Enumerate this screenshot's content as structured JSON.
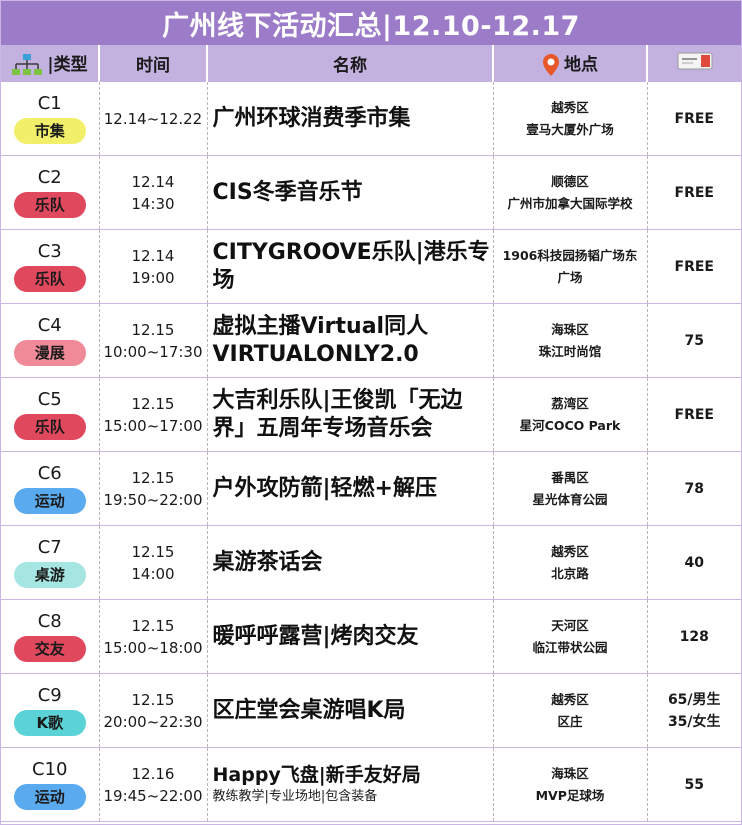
{
  "title": "广州线下活动汇总|12.10-12.17",
  "headers": {
    "type": "|类型",
    "time": "时间",
    "name": "名称",
    "location": "地点"
  },
  "icons": {
    "type": "hierarchy-icon",
    "location": "location-pin-icon",
    "ticket": "ticket-icon"
  },
  "colors": {
    "title_bg": "#9c7cc8",
    "header_bg": "#c3b1e0",
    "market": "#f2f06a",
    "band": "#e0485e",
    "comic": "#f08a98",
    "sport": "#5aaaf0",
    "boardgame": "#a6e6e2",
    "social": "#e0485e",
    "karaoke": "#5ad2d6"
  },
  "rows": [
    {
      "code": "C1",
      "tag": "市集",
      "tag_color": "#f2f06a",
      "time1": "12.14~12.22",
      "time2": "",
      "name": "广州环球消费季市集",
      "sub": "",
      "district": "越秀区",
      "place": "壹马大厦外广场",
      "price1": "FREE",
      "price2": ""
    },
    {
      "code": "C2",
      "tag": "乐队",
      "tag_color": "#e0485e",
      "time1": "12.14",
      "time2": "14:30",
      "name": "CIS冬季音乐节",
      "sub": "",
      "district": "顺德区",
      "place": "广州市加拿大国际学校",
      "price1": "FREE",
      "price2": ""
    },
    {
      "code": "C3",
      "tag": "乐队",
      "tag_color": "#e0485e",
      "time1": "12.14",
      "time2": "19:00",
      "name": "CITYGROOVE乐队|港乐专场",
      "sub": "",
      "district": "1906科技园扬韬广场东",
      "place": "广场",
      "price1": "FREE",
      "price2": ""
    },
    {
      "code": "C4",
      "tag": "漫展",
      "tag_color": "#f08a98",
      "time1": "12.15",
      "time2": "10:00~17:30",
      "name": "虚拟主播Virtual同人VIRTUALONLY2.0",
      "sub": "",
      "district": "海珠区",
      "place": "珠江时尚馆",
      "price1": "75",
      "price2": ""
    },
    {
      "code": "C5",
      "tag": "乐队",
      "tag_color": "#e0485e",
      "time1": "12.15",
      "time2": "15:00~17:00",
      "name": "大吉利乐队|王俊凯「无边界」五周年专场音乐会",
      "sub": "",
      "district": "荔湾区",
      "place": "星河COCO Park",
      "price1": "FREE",
      "price2": ""
    },
    {
      "code": "C6",
      "tag": "运动",
      "tag_color": "#5aaaf0",
      "time1": "12.15",
      "time2": "19:50~22:00",
      "name": "户外攻防箭|轻燃+解压",
      "sub": "",
      "district": "番禺区",
      "place": "星光体育公园",
      "price1": "78",
      "price2": ""
    },
    {
      "code": "C7",
      "tag": "桌游",
      "tag_color": "#a6e6e2",
      "time1": "12.15",
      "time2": "14:00",
      "name": "桌游茶话会",
      "sub": "",
      "district": "越秀区",
      "place": "北京路",
      "price1": "40",
      "price2": ""
    },
    {
      "code": "C8",
      "tag": "交友",
      "tag_color": "#e0485e",
      "time1": "12.15",
      "time2": "15:00~18:00",
      "name": "暖呼呼露营|烤肉交友",
      "sub": "",
      "district": "天河区",
      "place": "临江带状公园",
      "price1": "128",
      "price2": ""
    },
    {
      "code": "C9",
      "tag": "K歌",
      "tag_color": "#5ad2d6",
      "time1": "12.15",
      "time2": "20:00~22:30",
      "name": "区庄堂会桌游唱K局",
      "sub": "",
      "district": "越秀区",
      "place": "区庄",
      "price1": "65/男生",
      "price2": "35/女生"
    },
    {
      "code": "C10",
      "tag": "运动",
      "tag_color": "#5aaaf0",
      "time1": "12.16",
      "time2": "19:45~22:00",
      "name": "Happy飞盘|新手友好局",
      "sub": "教练教学|专业场地|包含装备",
      "district": "海珠区",
      "place": "MVP足球场",
      "price1": "55",
      "price2": ""
    }
  ]
}
